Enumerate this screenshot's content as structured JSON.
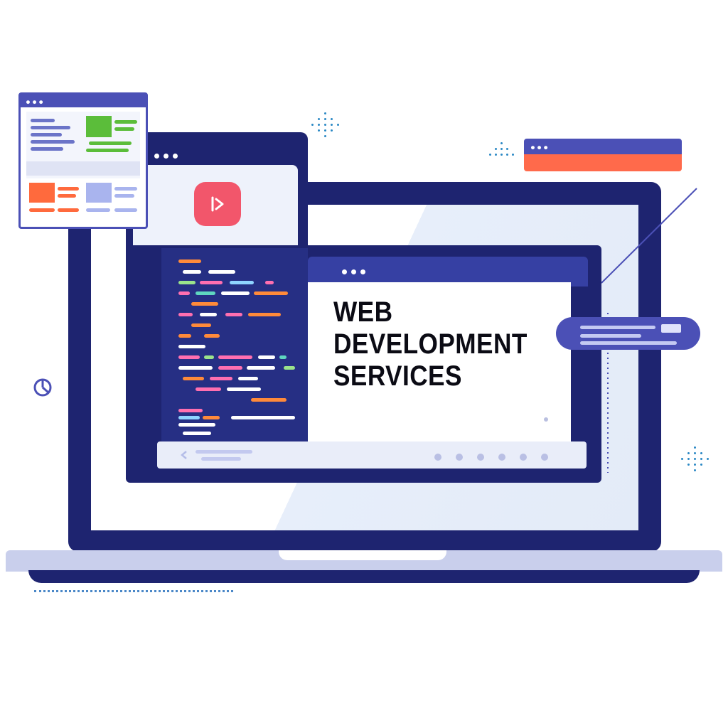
{
  "hero": {
    "line1": "WEB",
    "line2": "DEVELOPMENT",
    "line3": "SERVICES"
  },
  "colors": {
    "navy": "#1e2470",
    "indigo": "#4b50b6",
    "accent_red": "#f2566b",
    "accent_orange": "#ff6a3d",
    "accent_green": "#5bbd3a"
  },
  "icons": [
    "play-icon",
    "pie-chart-icon",
    "back-arrow-icon"
  ]
}
